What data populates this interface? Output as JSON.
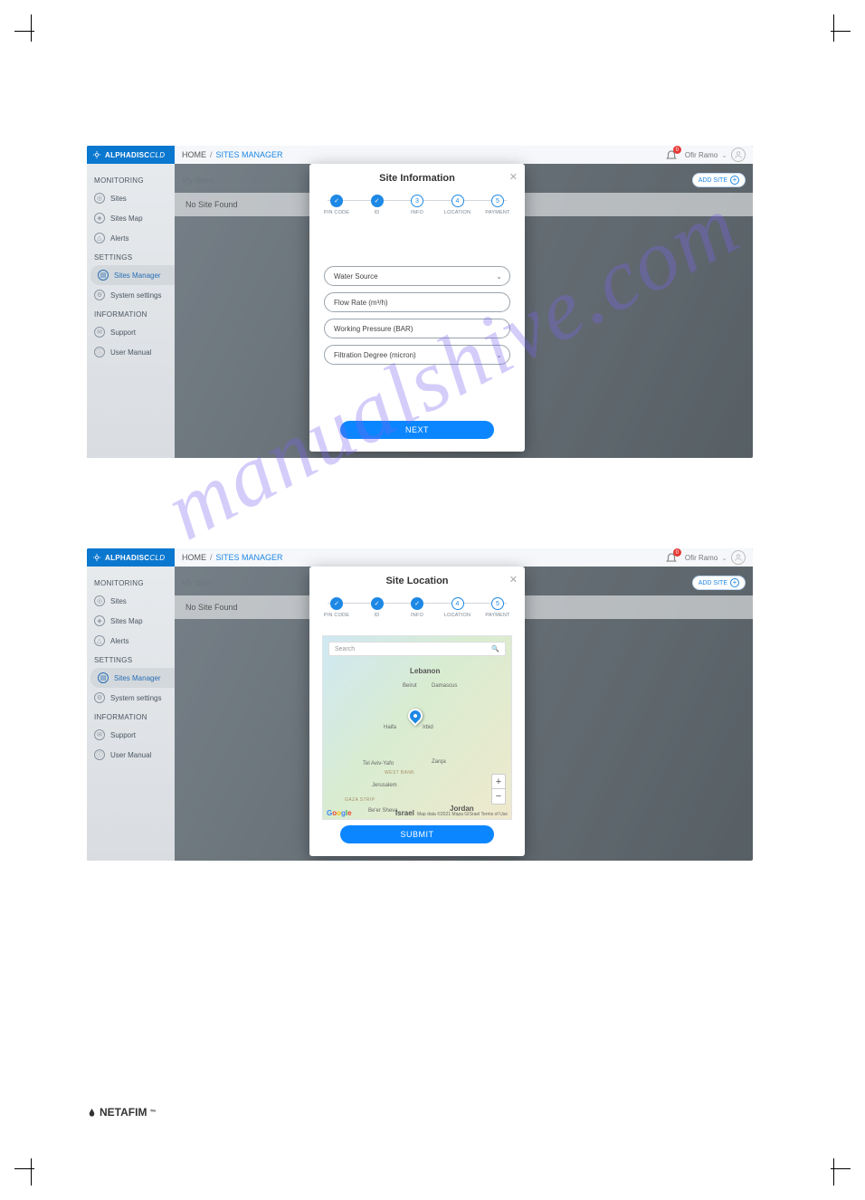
{
  "brand": "ALPHADISC",
  "brand_suffix": "CLD",
  "breadcrumb": {
    "home": "HOME",
    "sep": "/",
    "current": "SITES MANAGER"
  },
  "user": {
    "name": "Ofir Ramo",
    "notifications": "0"
  },
  "sidebar": {
    "monitoring": {
      "head": "MONITORING",
      "items": [
        "Sites",
        "Sites Map",
        "Alerts"
      ]
    },
    "settings": {
      "head": "SETTINGS",
      "items": [
        "Sites Manager",
        "System settings"
      ]
    },
    "information": {
      "head": "INFORMATION",
      "items": [
        "Support",
        "User Manual"
      ]
    }
  },
  "content": {
    "mysites": "My Sites",
    "nosite": "No Site Found",
    "addsite": "ADD SITE"
  },
  "steps": {
    "labels": [
      "PIN CODE",
      "ID",
      "INFO",
      "LOCATION",
      "PAYMENT"
    ],
    "nums": [
      "✓",
      "✓",
      "3",
      "4",
      "5"
    ]
  },
  "modal1": {
    "title": "Site Information",
    "fields": {
      "water_source": "Water Source",
      "flow_rate": "Flow Rate (m³/h)",
      "working_pressure": "Working Pressure (BAR)",
      "filtration_degree": "Filtration Degree (micron)"
    },
    "button": "NEXT"
  },
  "modal2": {
    "title": "Site Location",
    "search_placeholder": "Search",
    "button": "SUBMIT",
    "map": {
      "country1": "Lebanon",
      "country2": "Jordan",
      "country3": "Israel",
      "city_beirut": "Beirut",
      "city_damascus": "Damascus",
      "city_haifa": "Haifa",
      "city_telaviv": "Tel Aviv-Yafo",
      "city_jerusalem": "Jerusalem",
      "city_beersheva": "Be'er Sheva",
      "region_westbank": "WEST BANK",
      "region_gaza": "GAZA STRIP",
      "city_zarqa": "Zarqa",
      "city_irbid": "Irbid",
      "attribution": "Map data ©2021 Mapa GISrael   Terms of Use"
    }
  },
  "watermark": "manualshive.com",
  "footer_brand": "NETAFIM"
}
